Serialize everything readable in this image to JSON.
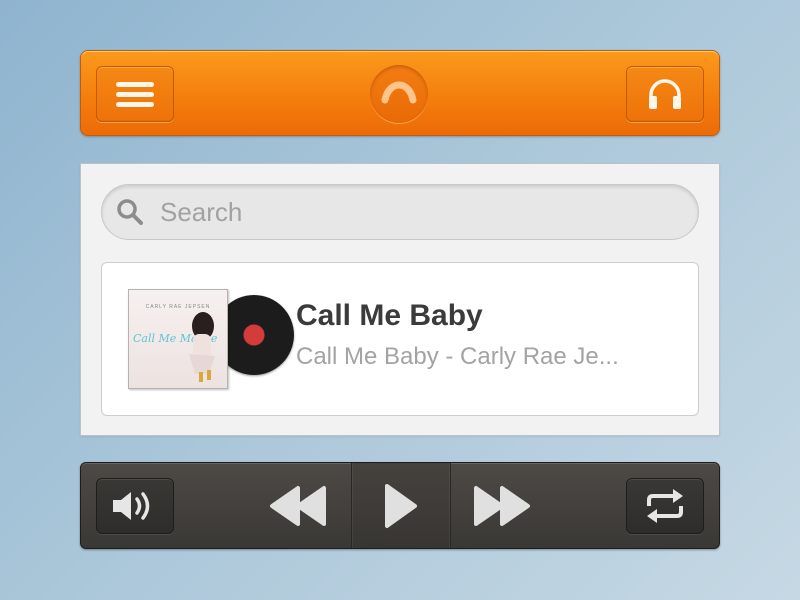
{
  "header": {
    "menu_icon": "hamburger-menu-icon",
    "logo_icon": "app-logo-icon",
    "headphones_icon": "headphones-icon",
    "colors": {
      "accent": "#f47c0c",
      "accent_dark": "#c75a05"
    }
  },
  "search": {
    "placeholder": "Search",
    "value": "",
    "icon": "search-icon"
  },
  "track": {
    "title": "Call Me Baby",
    "subtitle": "Call Me Baby - Carly Rae Je...",
    "cover_artist_text": "CARLY RAE JEPSEN",
    "cover_script_text": "Call Me Maybe"
  },
  "player": {
    "volume_icon": "volume-icon",
    "rewind_icon": "rewind-icon",
    "play_icon": "play-icon",
    "fast_forward_icon": "fast-forward-icon",
    "repeat_icon": "repeat-icon"
  }
}
